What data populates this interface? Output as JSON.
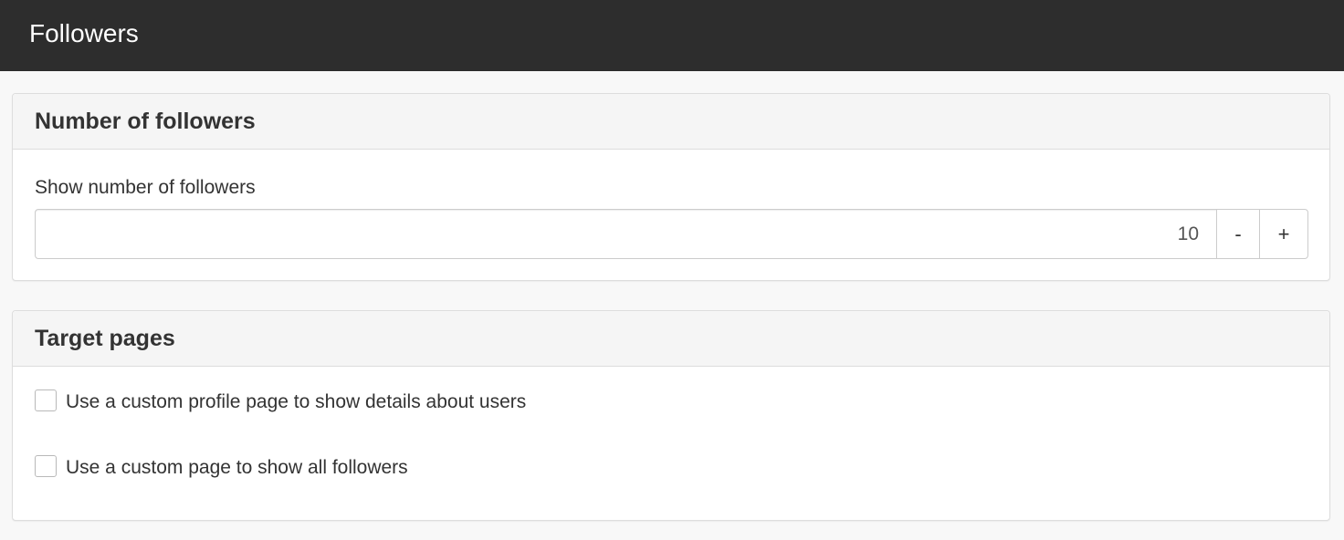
{
  "header": {
    "title": "Followers"
  },
  "panels": {
    "followers": {
      "heading": "Number of followers",
      "field_label": "Show number of followers",
      "value": "10",
      "decrement_label": "-",
      "increment_label": "+"
    },
    "target": {
      "heading": "Target pages",
      "options": [
        {
          "label": "Use a custom profile page to show details about users",
          "checked": false
        },
        {
          "label": "Use a custom page to show all followers",
          "checked": false
        }
      ]
    }
  },
  "colors": {
    "header_bg": "#2d2d2d",
    "page_bg": "#f8f8f8",
    "panel_heading_bg": "#f5f5f5",
    "border": "#dddddd"
  }
}
